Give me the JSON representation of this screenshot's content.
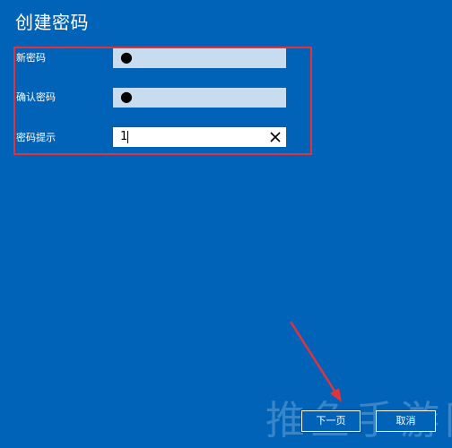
{
  "dialog": {
    "title": "创建密码"
  },
  "form": {
    "new_password": {
      "label": "新密码",
      "value": "●"
    },
    "confirm_password": {
      "label": "确认密码",
      "value": "●"
    },
    "password_hint": {
      "label": "密码提示",
      "value": "1"
    }
  },
  "buttons": {
    "next": "下一页",
    "cancel": "取消"
  },
  "watermark": "推鱼手游网",
  "icons": {
    "clear": "close-icon"
  },
  "colors": {
    "background": "#0063b8",
    "annotation": "#e2333d",
    "masked_field": "#c8dcf0"
  }
}
